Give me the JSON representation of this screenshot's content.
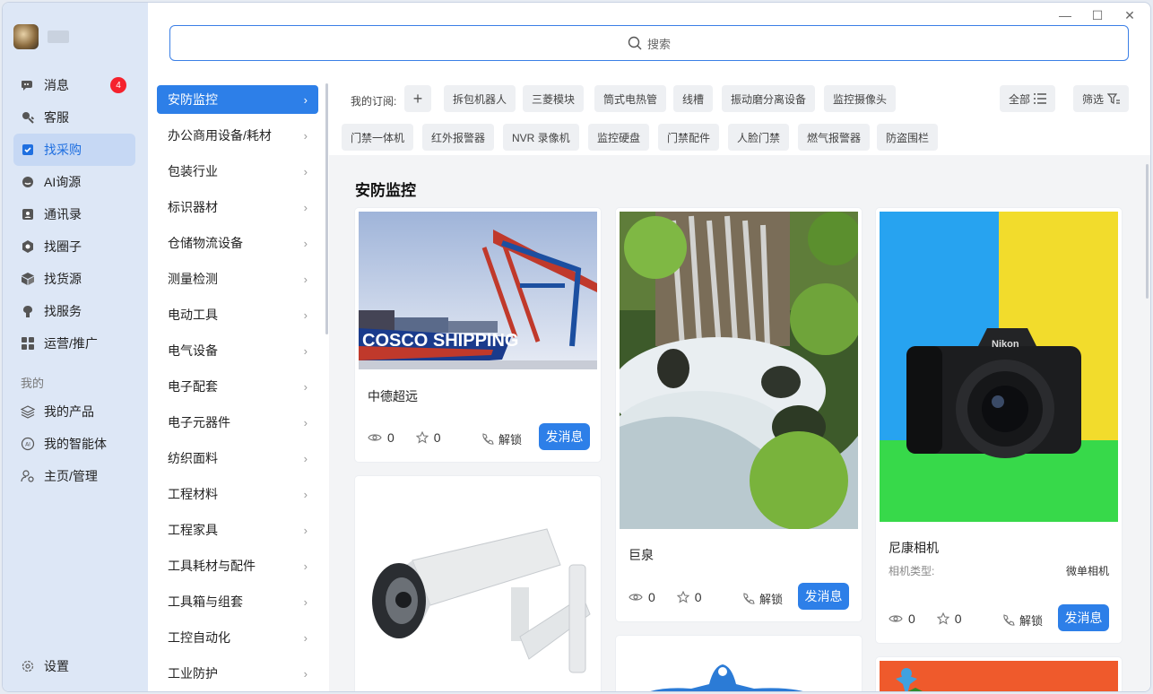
{
  "window": {
    "minimize": "—",
    "maximize": "☐",
    "close": "✕"
  },
  "search": {
    "placeholder": "搜索"
  },
  "nav": {
    "items": [
      {
        "label": "消息",
        "icon": "chat-icon",
        "badge": "4"
      },
      {
        "label": "客服",
        "icon": "service-icon"
      },
      {
        "label": "找采购",
        "icon": "purchase-icon",
        "active": true
      },
      {
        "label": "AI询源",
        "icon": "ai-chat-icon"
      },
      {
        "label": "通讯录",
        "icon": "contacts-icon"
      },
      {
        "label": "找圈子",
        "icon": "circle-icon"
      },
      {
        "label": "找货源",
        "icon": "box-icon"
      },
      {
        "label": "找服务",
        "icon": "service-hand-icon"
      },
      {
        "label": "运营/推广",
        "icon": "grid-icon"
      }
    ],
    "section_label": "我的",
    "my_items": [
      {
        "label": "我的产品",
        "icon": "layers-icon"
      },
      {
        "label": "我的智能体",
        "icon": "ai-agent-icon"
      },
      {
        "label": "主页/管理",
        "icon": "user-settings-icon"
      }
    ],
    "settings_label": "设置"
  },
  "categories": [
    "安防监控",
    "办公商用设备/耗材",
    "包装行业",
    "标识器材",
    "仓储物流设备",
    "测量检测",
    "电动工具",
    "电气设备",
    "电子配套",
    "电子元器件",
    "纺织面料",
    "工程材料",
    "工程家具",
    "工具耗材与配件",
    "工具箱与组套",
    "工控自动化",
    "工业防护"
  ],
  "subscriptions": {
    "label": "我的订阅:",
    "row1": [
      "拆包机器人",
      "三菱模块",
      "筒式电热管",
      "线槽",
      "振动磨分离设备",
      "监控摄像头"
    ],
    "row2": [
      "门禁一体机",
      "红外报警器",
      "NVR 录像机",
      "监控硬盘",
      "门禁配件",
      "人脸门禁",
      "燃气报警器",
      "防盗围栏"
    ],
    "all_label": "全部",
    "filter_label": "筛选"
  },
  "section_title": "安防监控",
  "cards": [
    {
      "title": "中德超远",
      "views": "0",
      "stars": "0",
      "unlock": "解锁",
      "message": "发消息",
      "image": "port-cranes-ship",
      "ship_text": "COSCO SHIPPING"
    },
    {
      "title": "巨泉",
      "views": "0",
      "stars": "0",
      "unlock": "解锁",
      "message": "发消息",
      "image": "waterfall"
    },
    {
      "title": "尼康相机",
      "meta_label": "相机类型:",
      "meta_value": "微单相机",
      "views": "0",
      "stars": "0",
      "unlock": "解锁",
      "message": "发消息",
      "image": "nikon-camera",
      "brand_text": "Nikon"
    },
    {
      "image": "security-camera"
    },
    {
      "image": "blue-product"
    },
    {
      "image": "orange-banner"
    }
  ]
}
